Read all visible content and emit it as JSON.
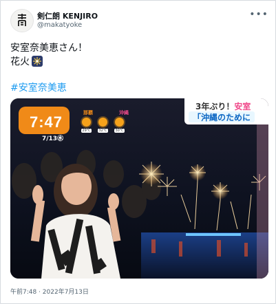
{
  "tweet": {
    "display_name": "剣仁朗 KENJIRO",
    "handle": "@makatyoke",
    "text_line1": "安室奈美恵さん！",
    "text_line2": "花火",
    "hashtag": "#安室奈美恵",
    "timestamp": "午前7:48 · 2022年7月13日"
  },
  "media": {
    "clock_time": "7:47",
    "clock_date": "7/13㊌",
    "weather_city_1": "那覇",
    "weather_city_2": "沖縄",
    "temp_1": "29℃",
    "temp_2": "32℃",
    "temp_3": "30℃",
    "ticker_line1_prefix": "3年ぶり！",
    "ticker_line1_suffix": "安室",
    "ticker_line2": "「沖縄のために"
  },
  "colors": {
    "hashtag": "#1d9bf0",
    "clock_badge": "#f08a18",
    "ticker_accent": "#f04a8b",
    "ticker_text": "#0b66c3"
  },
  "icons": [
    "more-icon",
    "fireworks-emoji-icon",
    "sun-icon",
    "avatar-logo-icon"
  ]
}
